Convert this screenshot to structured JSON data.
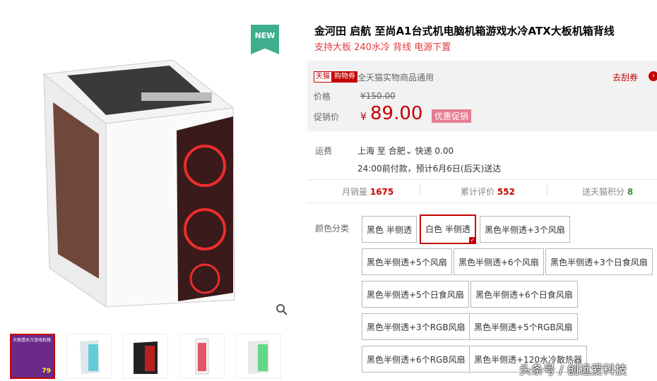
{
  "product": {
    "title": "金河田 启航 至尚A1台式机电脑机箱游戏水冷ATX大板机箱背线",
    "subtitle": "支持大板 240水冷 背线 电源下置",
    "badge": "NEW"
  },
  "coupon": {
    "tag1": "天猫",
    "tag2": "购物券",
    "text": "全天猫实物商品通用",
    "action": "去刮券"
  },
  "price": {
    "label": "价格",
    "currency": "¥",
    "original": "150.00",
    "promo_label": "促销价",
    "promo_currency": "¥",
    "promo": "89.00",
    "promo_tag": "优惠促销"
  },
  "shipping": {
    "label": "运费",
    "from": "上海",
    "to_word": "至",
    "to": "合肥",
    "express": "快递 0.00",
    "eta": "24:00前付款，预计6月6日(后天)送达"
  },
  "stats": {
    "sales_label": "月销量",
    "sales": "1675",
    "reviews_label": "累计评价",
    "reviews": "552",
    "points_label": "送天猫积分",
    "points": "8"
  },
  "options": {
    "label": "颜色分类",
    "items": [
      "黑色 半侧透",
      "白色 半侧透",
      "黑色半侧透+3个风扇",
      "黑色半侧透+5个风扇",
      "黑色半侧透+6个风扇",
      "黑色半侧透+3个日食风扇",
      "黑色半侧透+5个日食风扇",
      "黑色半侧透+6个日食风扇",
      "黑色半侧透+3个RGB风扇",
      "黑色半侧透+5个RGB风扇",
      "黑色半侧透+6个RGB风扇",
      "黑色半侧透+120水冷散热器"
    ],
    "selected_index": 1
  },
  "thumbs": {
    "thumb1_text": "大侧透水冷游戏机箱",
    "thumb1_price": "79"
  },
  "watermark": "头条号 / 创远爱科技",
  "colors": {
    "accent": "#c40000",
    "badge": "#3fae8e"
  }
}
